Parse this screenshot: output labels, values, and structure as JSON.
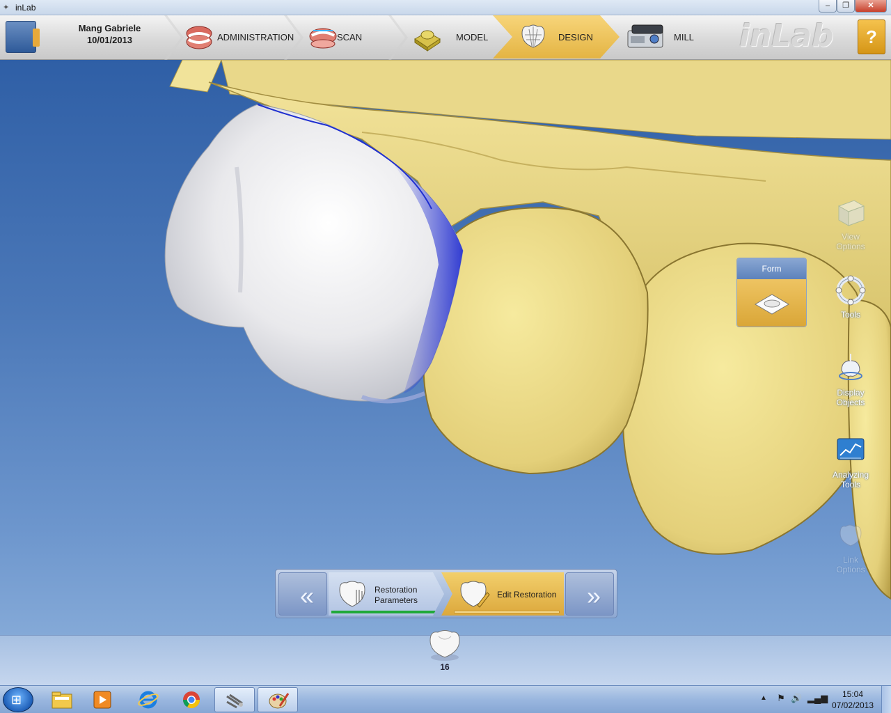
{
  "window": {
    "title": "inLab",
    "minimize": "‒",
    "maximize": "❐",
    "close": "✕"
  },
  "header": {
    "patient_name": "Mang Gabriele",
    "patient_date": "10/01/2013",
    "steps": [
      {
        "label": "ADMINISTRATION",
        "icon": "denture-icon"
      },
      {
        "label": "SCAN",
        "icon": "scan-denture-icon"
      },
      {
        "label": "MODEL",
        "icon": "model-block-icon"
      },
      {
        "label": "DESIGN",
        "icon": "crown-mesh-icon",
        "active": true
      },
      {
        "label": "MILL",
        "icon": "milling-machine-icon"
      }
    ],
    "brand": "inLab",
    "help": "?"
  },
  "colors": {
    "accent": "#e4b443",
    "model": "#e6d487",
    "restoration": "#f2f2f2",
    "margin": "#1f2fd0",
    "background": "#3e6aa8"
  },
  "side_tools": [
    {
      "label_1": "View",
      "label_2": "Options",
      "icon": "cube-icon"
    },
    {
      "label_1": "Tools",
      "label_2": "",
      "icon": "tools-ring-icon"
    },
    {
      "label_1": "Display",
      "label_2": "Objects",
      "icon": "display-objects-icon"
    },
    {
      "label_1": "Analyzing",
      "label_2": "Tools",
      "icon": "analyzing-chart-icon"
    },
    {
      "label_1": "Link",
      "label_2": "Options",
      "icon": "link-tooth-icon"
    }
  ],
  "form_panel": {
    "title": "Form",
    "icon": "form-tool-icon"
  },
  "phase_bar": {
    "prev": "«",
    "next": "»",
    "steps": [
      {
        "label_1": "Restoration",
        "label_2": "Parameters",
        "progress": 1.0
      },
      {
        "label": "Edit Restoration",
        "active": true
      }
    ]
  },
  "tooth": {
    "number": "16"
  },
  "taskbar": {
    "start": "⊞",
    "items": [
      "folder-icon",
      "media-player-icon",
      "internet-explorer-icon",
      "chrome-icon",
      "inlab-app-icon",
      "paint-icon"
    ],
    "tray": {
      "arrow": "▲",
      "time": "15:04",
      "date": "07/02/2013"
    }
  }
}
